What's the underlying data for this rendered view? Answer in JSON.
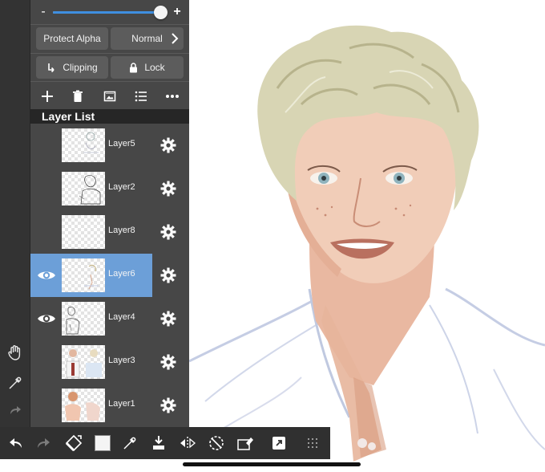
{
  "panel": {
    "buttons": {
      "protect_alpha": "Protect Alpha",
      "blend_mode": "Normal",
      "clipping": "Clipping",
      "lock": "Lock"
    },
    "slider": {
      "minus": "-",
      "plus": "+",
      "value_fraction": 0.97
    },
    "layer_list_title": "Layer List",
    "toolbar_icons": [
      "add-layer-icon",
      "delete-layer-icon",
      "import-image-icon",
      "layer-list-menu-icon",
      "more-options-icon"
    ],
    "layers": [
      {
        "name": "Layer5",
        "visible": false,
        "selected": false
      },
      {
        "name": "Layer2",
        "visible": false,
        "selected": false
      },
      {
        "name": "Layer8",
        "visible": false,
        "selected": false
      },
      {
        "name": "Layer6",
        "visible": true,
        "selected": true
      },
      {
        "name": "Layer4",
        "visible": true,
        "selected": false
      },
      {
        "name": "Layer3",
        "visible": false,
        "selected": false
      },
      {
        "name": "Layer1",
        "visible": false,
        "selected": false
      }
    ]
  },
  "left_strip_icons": [
    "hand-icon",
    "eyedropper-icon",
    "redo-icon"
  ],
  "bottom_toolbar_icons": [
    "undo-icon",
    "redo-icon",
    "transform-icon",
    "color-swatch",
    "eyedropper-icon",
    "fill-icon",
    "flip-icon",
    "rotate-icon",
    "eraser-icon",
    "export-icon",
    "grid-icon"
  ],
  "colors": {
    "panel_bg": "#474747",
    "selected_layer": "#6c9fd8",
    "slider_accent": "#3f8fe0",
    "toolbar_bg": "#303030"
  }
}
